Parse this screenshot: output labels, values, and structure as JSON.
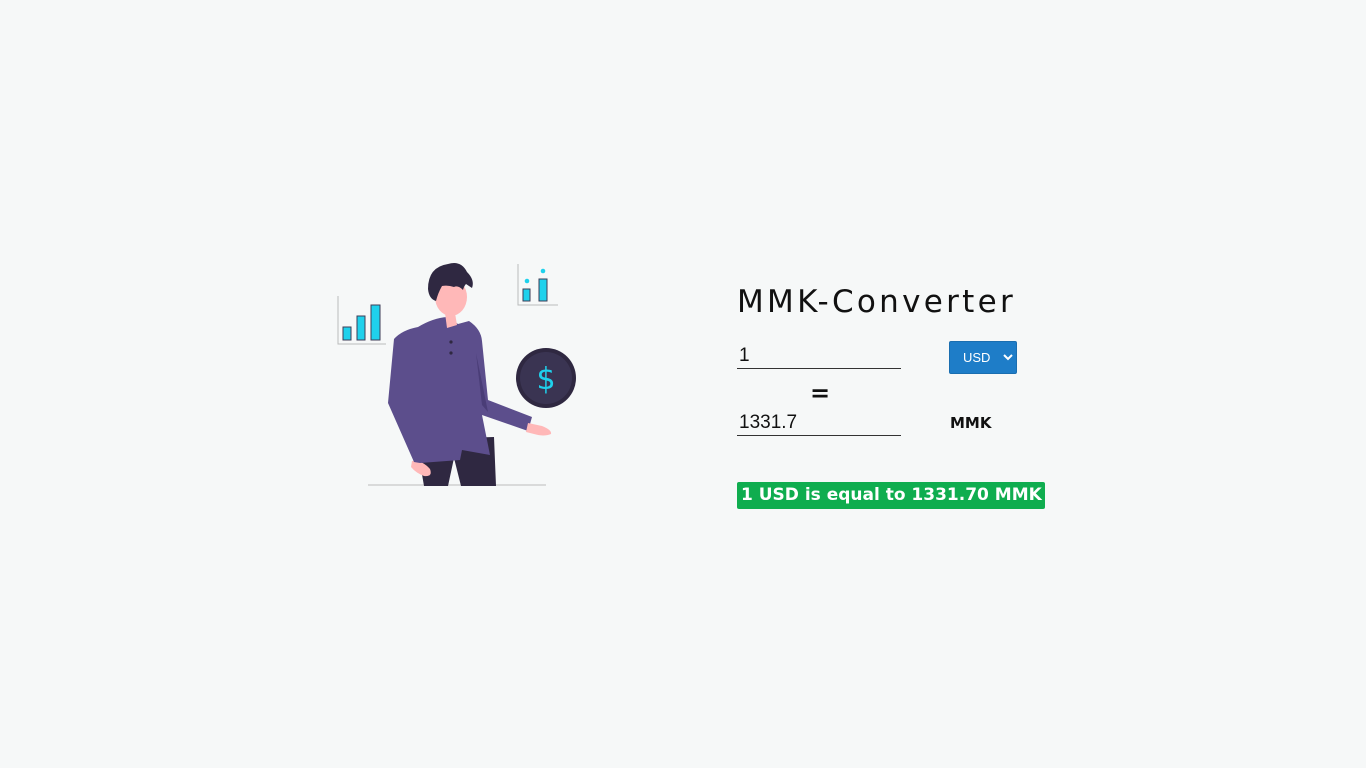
{
  "app": {
    "title": "MMK-Converter"
  },
  "form": {
    "amount_value": "1",
    "currency_selected": "USD",
    "currency_options": [
      "USD"
    ],
    "equals_sign": "=",
    "result_value": "1331.7",
    "target_currency": "MMK"
  },
  "result": {
    "message": "1 USD is equal to 1331.70 MMK"
  },
  "colors": {
    "page_background": "#f6f8f8",
    "select_background": "#1e7dc8",
    "banner_background": "#0fad4f",
    "illustration_shirt": "#5c4e8c",
    "illustration_accent": "#1fd1ec",
    "illustration_dark": "#2f2841"
  },
  "icons": {
    "illustration": "person-with-dollar-coin-illustration",
    "coin": "dollar-coin-icon",
    "charts": "bar-chart-icon"
  }
}
